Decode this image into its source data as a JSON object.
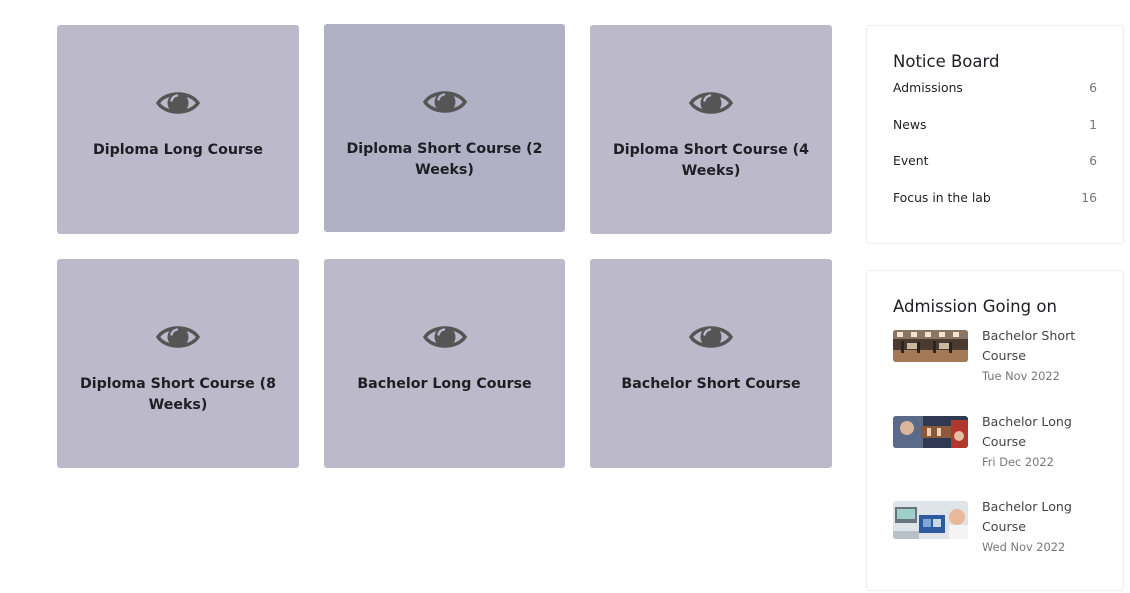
{
  "courses": [
    {
      "title": "Diploma Long Course",
      "icon": "eye-icon"
    },
    {
      "title": "Diploma Short Course (2 Weeks)",
      "icon": "eye-icon"
    },
    {
      "title": "Diploma Short Course (4 Weeks)",
      "icon": "eye-icon"
    },
    {
      "title": "Diploma Short Course (8 Weeks)",
      "icon": "eye-icon"
    },
    {
      "title": "Bachelor Long Course",
      "icon": "eye-icon"
    },
    {
      "title": "Bachelor Short Course",
      "icon": "eye-icon"
    }
  ],
  "notice_board": {
    "title": "Notice Board",
    "items": [
      {
        "label": "Admissions",
        "count": "6"
      },
      {
        "label": "News",
        "count": "1"
      },
      {
        "label": "Event",
        "count": "6"
      },
      {
        "label": "Focus in the lab",
        "count": "16"
      }
    ]
  },
  "admission": {
    "title": "Admission Going on",
    "items": [
      {
        "title": "Bachelor Short Course",
        "date": "Tue Nov 2022"
      },
      {
        "title": "Bachelor Long Course",
        "date": "Fri Dec 2022"
      },
      {
        "title": "Bachelor Long Course",
        "date": "Wed Nov 2022"
      }
    ]
  },
  "colors": {
    "card_bg": "#bcbaca",
    "card_bg_hover": "#b1b0c5",
    "eye_icon": "#555555"
  }
}
